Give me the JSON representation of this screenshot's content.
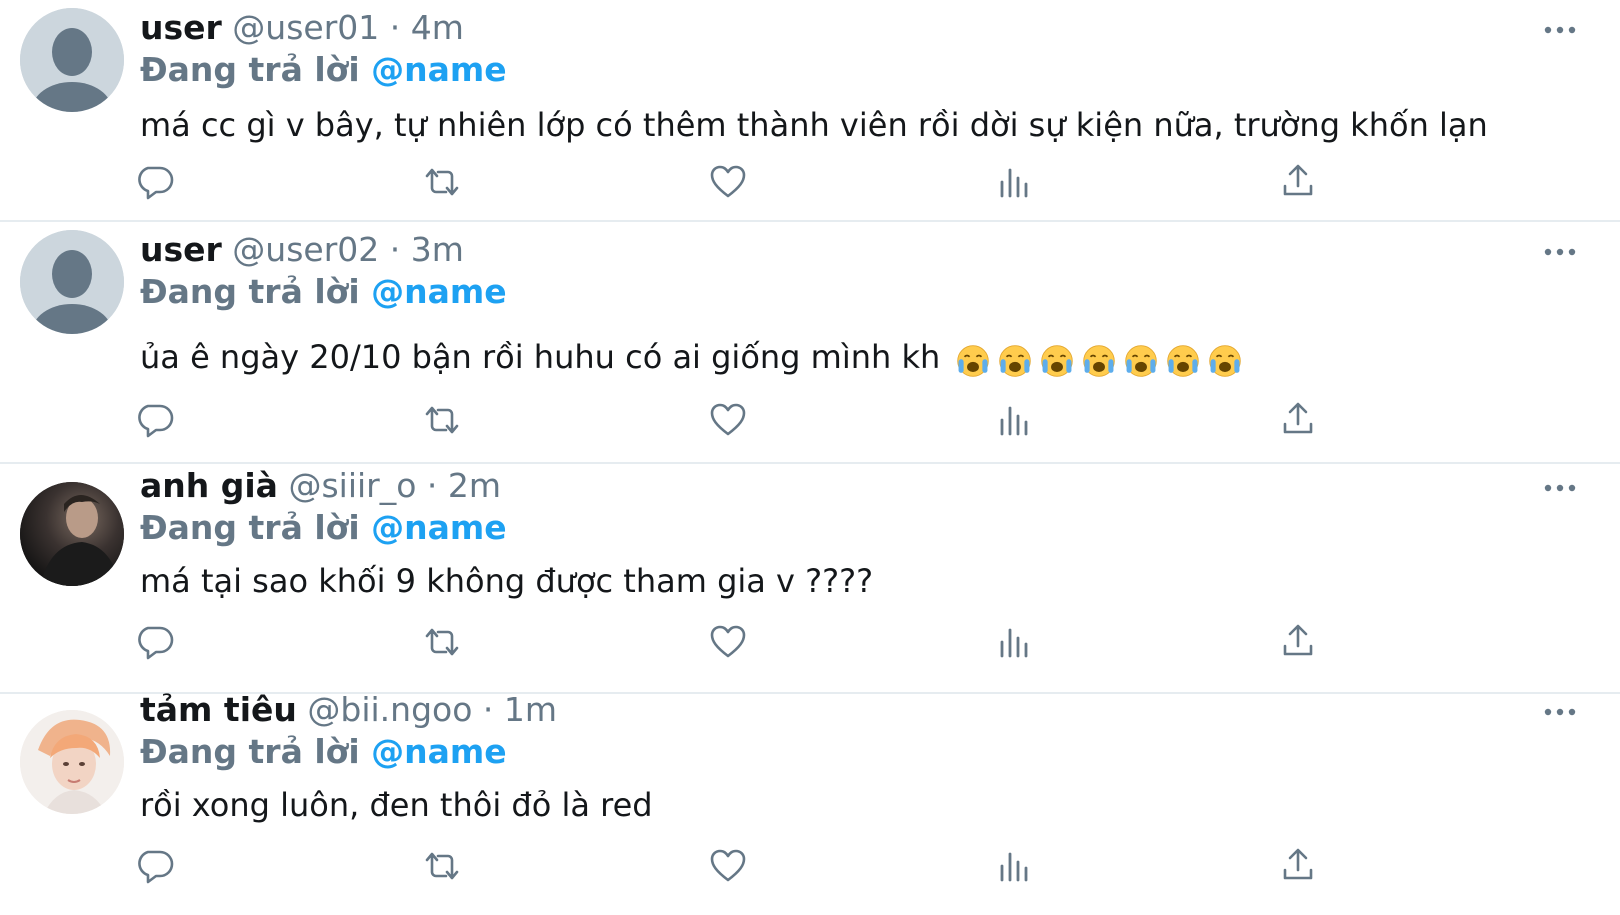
{
  "reply_prefix": "Đang trả lời",
  "colors": {
    "accent": "#1da1f2",
    "secondary_text": "#657786",
    "primary_text": "#14171a",
    "divider": "#e6ecf0"
  },
  "icons": {
    "reply": "speech-bubble-icon",
    "retweet": "retweet-icon",
    "like": "heart-icon",
    "analytics": "bar-chart-icon",
    "share": "share-upload-icon",
    "more": "more-dots-icon"
  },
  "tweets": [
    {
      "display_name": "user",
      "handle": "@user01",
      "separator": "·",
      "time": "4m",
      "mention": "@name",
      "text": "má cc gì v bây, tự nhiên lớp có thêm thành viên rồi dời sự kiện nữa, trường khốn lạn",
      "avatar": "default-profile-icon",
      "emoji_count": 0
    },
    {
      "display_name": "user",
      "handle": "@user02",
      "separator": "·",
      "time": "3m",
      "mention": "@name",
      "text": "ủa ê ngày 20/10 bận rồi huhu có ai giống mình kh",
      "avatar": "default-profile-icon",
      "emoji": "loudly-crying-face-emoji",
      "emoji_count": 7
    },
    {
      "display_name": "anh già",
      "handle": "@siiir_o",
      "separator": "·",
      "time": "2m",
      "mention": "@name",
      "text": "má tại sao khối 9 không được tham gia v ????",
      "avatar": "dark-photo-avatar",
      "emoji_count": 0
    },
    {
      "display_name": "tảm tiêu",
      "handle": "@bii.ngoo",
      "separator": "·",
      "time": "1m",
      "mention": "@name",
      "text": "rồi xong luôn, đen thôi đỏ là red",
      "avatar": "light-photo-avatar",
      "emoji_count": 0
    }
  ]
}
